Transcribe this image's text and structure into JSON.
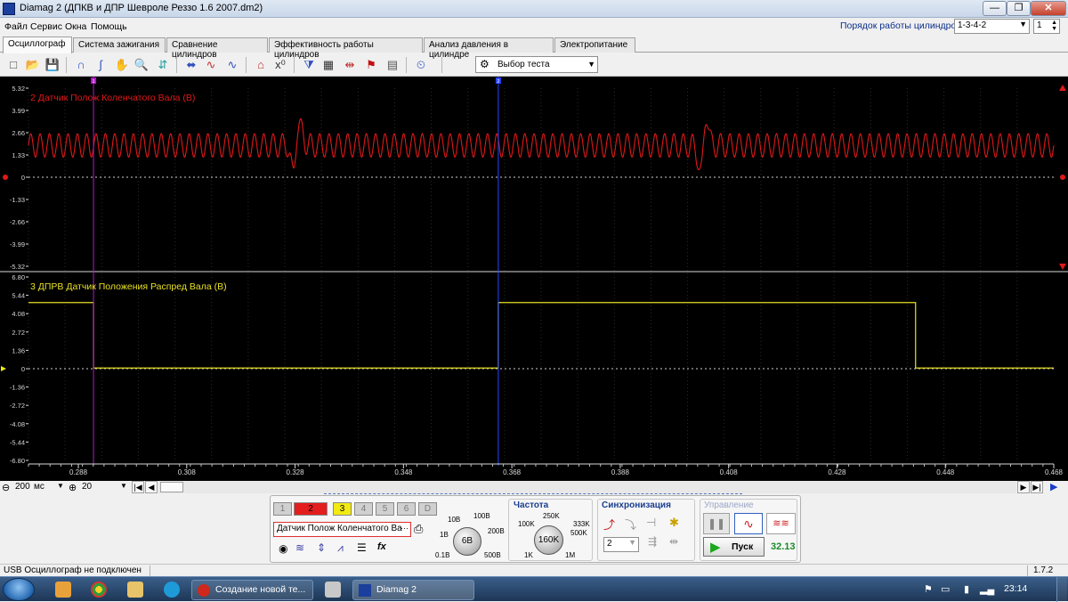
{
  "window": {
    "title": "Diamag 2 (ДПКВ и ДПР Шевроле Реззо 1.6 2007.dm2)",
    "min_label": "—",
    "max_label": "❐",
    "close_label": "✕"
  },
  "menu": [
    "Файл",
    "Сервис",
    "Окна",
    "Помощь"
  ],
  "cylinder_order": {
    "label": "Порядок работы цилиндров",
    "value": "1-3-4-2",
    "cyl_value": "1"
  },
  "tabs": [
    "Осциллограф",
    "Система зажигания",
    "Сравнение цилиндров",
    "Эффективность работы цилиндров",
    "Анализ давления в цилиндре",
    "Электропитание"
  ],
  "toolbar": {
    "test_select": "Выбор теста",
    "icons": [
      "new-icon",
      "open-icon",
      "save-icon",
      "cursor-a-icon",
      "cursor-b-icon",
      "hand-icon",
      "zoom-icon",
      "zoom-fit-icon",
      "split-icon",
      "waves-icon",
      "overlay-icon",
      "auto-icon",
      "math-icon",
      "filter-icon",
      "table-icon",
      "marker-icon",
      "flag-icon",
      "note-icon",
      "auto-test-icon"
    ],
    "glyphs": [
      "□",
      "📂",
      "💾",
      "∩",
      "∫",
      "✋",
      "🔍",
      "⇵",
      "⬌",
      "∿",
      "∿",
      "⌂",
      "x⁰",
      "⧩",
      "▦",
      "⇹",
      "⚑",
      "▤",
      "⏲"
    ]
  },
  "scope": {
    "cursor_a_label": "1",
    "cursor_b_label": "2",
    "ch2": {
      "name": "2 Датчик Полож Коленчатого Вала (В)",
      "color": "#e01818",
      "ticks": [
        "5.32",
        "3.99",
        "2.66",
        "1.33",
        "0",
        "-1.33",
        "-2.66",
        "-3.99",
        "-5.32"
      ]
    },
    "ch3": {
      "name": "3 ДПРВ Датчик Положения Распред Вала (В)",
      "color": "#e8e024",
      "ticks": [
        "6.80",
        "5.44",
        "4.08",
        "2.72",
        "1.36",
        "0",
        "-1.36",
        "-2.72",
        "-4.08",
        "-5.44",
        "-6.80"
      ]
    },
    "time_ticks": [
      "0.288",
      "0.308",
      "0.328",
      "0.348",
      "0.368",
      "0.388",
      "0.408",
      "0.428",
      "0.448",
      "0.468"
    ],
    "time_range": [
      0.2788,
      0.468
    ],
    "crank_teeth_visible": 110,
    "crank_gaps_time": [
      0.3283,
      0.4033
    ],
    "cam_high_until": 0.2908,
    "cam_low_until": 0.3655,
    "cam_high_again_until": 0.4425,
    "cam_high_v": 4.9,
    "cursor_a_time": 0.2908,
    "cursor_b_time": 0.3655
  },
  "scrollbar": {
    "timebase_value": "200",
    "timebase_unit": "мс",
    "step_value": "20"
  },
  "control": {
    "channels": [
      "1",
      "2",
      "3",
      "4",
      "5",
      "6",
      "D"
    ],
    "sensor_select": "Датчик Полож Коленчатого Ва",
    "range_knob": {
      "value": "6В",
      "labels": [
        "10В",
        "100В",
        "1В",
        "200В",
        "0.1В",
        "500В"
      ]
    },
    "freq_title": "Частота",
    "freq_knob": {
      "value": "160K",
      "labels": [
        "250K",
        "100K",
        "333K",
        "500K",
        "1K",
        "1M"
      ]
    },
    "sync_title": "Синхронизация",
    "sync_value": "2",
    "control_title": "Управление",
    "start_label": "Пуск",
    "fps": "32.13"
  },
  "status": {
    "message": "USB Осциллограф не подключен",
    "version": "1.7.2"
  },
  "taskbar": {
    "items": [
      "Создание новой те...",
      "Diamag 2"
    ],
    "clock": "23:14"
  },
  "colors": {
    "ch1": "#e0e0e0",
    "ch2": "#e01818",
    "ch3": "#f2ea10",
    "grid_dots": "#d0d0d0",
    "cursor_a": "#b418c8",
    "cursor_b": "#2a44ff"
  }
}
